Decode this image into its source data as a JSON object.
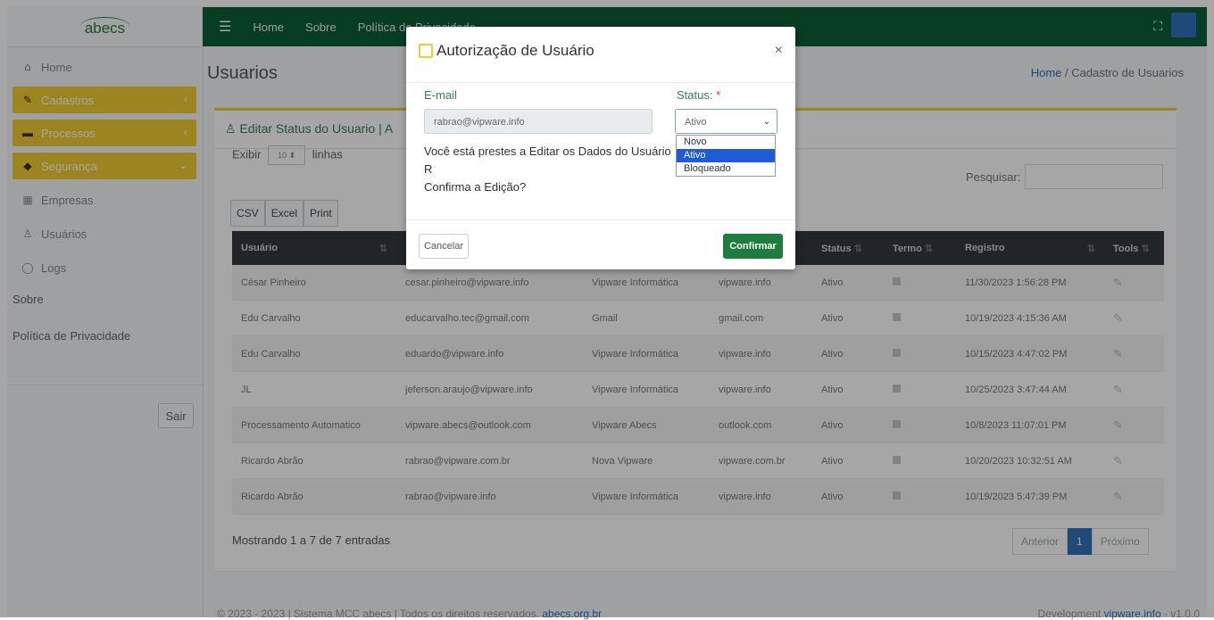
{
  "sidebar": {
    "brand": "abecs",
    "items": [
      {
        "label": "Home",
        "icon": "home-icon"
      },
      {
        "label": "Cadastros",
        "icon": "edit-icon"
      },
      {
        "label": "Processos",
        "icon": "server-icon"
      },
      {
        "label": "Segurança",
        "icon": "shield-icon"
      },
      {
        "label": "Empresas",
        "icon": "building-icon"
      },
      {
        "label": "Usuários",
        "icon": "user-icon"
      },
      {
        "label": "Logs",
        "icon": "comment-icon"
      }
    ],
    "sobre": "Sobre",
    "politica": "Política de Privacidade",
    "sair": "Sair"
  },
  "topbar": {
    "links": [
      "Home",
      "Sobre",
      "Política de Privacidade"
    ]
  },
  "content": {
    "title": "Usuarios",
    "breadcrumb_home": "Home",
    "breadcrumb_sep": "/",
    "breadcrumb_current": "Cadastro de Usuarios",
    "card_title": "Editar Status do Usuario | A",
    "exibir": "Exibir",
    "exibir_value": "10",
    "linhas": "linhas",
    "pesquisar": "Pesquisar:",
    "export_buttons": [
      "CSV",
      "Excel",
      "Print"
    ],
    "columns": [
      "Usuário",
      "",
      "",
      "",
      "Status",
      "Termo",
      "Registro",
      "Tools"
    ],
    "rows": [
      [
        "César Pinheiro",
        "cesar.pinheiro@vipware.info",
        "Vipware Informática",
        "vipware.info",
        "Ativo",
        "11/30/2023 1:56:28 PM"
      ],
      [
        "Edu Carvalho",
        "educarvalho.tec@gmail.com",
        "Gmail",
        "gmail.com",
        "Ativo",
        "10/19/2023 4:15:36 AM"
      ],
      [
        "Edu Carvalho",
        "eduardo@vipware.info",
        "Vipware Informática",
        "vipware.info",
        "Ativo",
        "10/15/2023 4:47:02 PM"
      ],
      [
        "JL",
        "jeferson.araujo@vipware.info",
        "Vipware Informática",
        "vipware.info",
        "Ativo",
        "10/25/2023 3:47:44 AM"
      ],
      [
        "Processamento Automatico",
        "vipware.abecs@outlook.com",
        "Vipware Abecs",
        "outlook.com",
        "Ativo",
        "10/8/2023 11:07:01 PM"
      ],
      [
        "Ricardo Abrão",
        "rabrao@vipware.com.br",
        "Nova Vipware",
        "vipware.com.br",
        "Ativo",
        "10/20/2023 10:32:51 AM"
      ],
      [
        "Ricardo Abrão",
        "rabrao@vipware.info",
        "Vipware Informática",
        "vipware.info",
        "Ativo",
        "10/19/2023 5:47:39 PM"
      ]
    ],
    "mostrando": "Mostrando 1 a 7 de 7 entradas",
    "pager": {
      "prev": "Anterior",
      "page": "1",
      "next": "Próximo"
    }
  },
  "footer": {
    "left_text": "© 2023 - 2023 | Sistema MCC abecs | Todos os direitos reservados.",
    "left_link": "abecs.org.br",
    "right_text": "Development",
    "right_link": "vipware.info",
    "version": "- v1.0.0"
  },
  "modal": {
    "title": "Autorização de Usuário",
    "close": "×",
    "email_label": "E-mail",
    "email_value": "rabrao@vipware.info",
    "status_label": "Status:",
    "status_required": "*",
    "status_value": "Ativo",
    "options": [
      "Novo",
      "Ativo",
      "Bloqueado"
    ],
    "selected_option": "Ativo",
    "message_1": "Você está prestes a Editar os Dados do Usuário R",
    "message_2": "Confirma a Edição?",
    "cancel": "Cancelar",
    "confirm": "Confirmar"
  }
}
